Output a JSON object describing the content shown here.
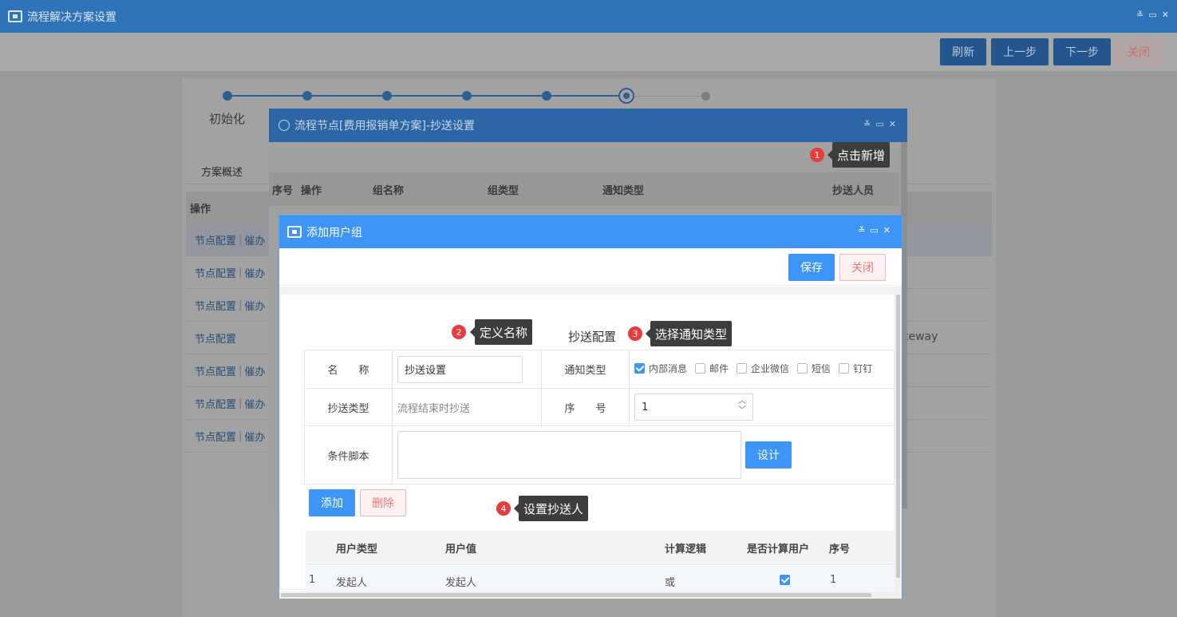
{
  "window": {
    "title": "流程解决方案设置",
    "controls": [
      "≚",
      "▭",
      "✕"
    ]
  },
  "toolbar": {
    "refresh": "刷新",
    "prev": "上一步",
    "next": "下一步",
    "close": "关闭"
  },
  "background": {
    "step_label": "初始化",
    "tab": "方案概述",
    "table_header": "操作",
    "rows": [
      {
        "a": "节点配置",
        "b": "催办"
      },
      {
        "a": "节点配置",
        "b": "催办"
      },
      {
        "a": "节点配置",
        "b": "催办"
      },
      {
        "a": "节点配置",
        "b": ""
      },
      {
        "a": "节点配置",
        "b": "催办"
      },
      {
        "a": "节点配置",
        "b": "催办"
      },
      {
        "a": "节点配置",
        "b": "催办"
      }
    ],
    "gateway_text": "teway"
  },
  "dialog2": {
    "title": "流程节点[费用报销单方案]-抄送设置",
    "columns": [
      "序号",
      "操作",
      "组名称",
      "组类型",
      "通知类型",
      "抄送人员"
    ]
  },
  "dialog1": {
    "title": "添加用户组",
    "save": "保存",
    "close": "关闭",
    "section_title": "抄送配置",
    "form": {
      "name_label": "名　　称",
      "name_value": "抄送设置",
      "notify_label": "通知类型",
      "notify_options": [
        {
          "label": "内部消息",
          "checked": true
        },
        {
          "label": "邮件",
          "checked": false
        },
        {
          "label": "企业微信",
          "checked": false
        },
        {
          "label": "短信",
          "checked": false
        },
        {
          "label": "钉钉",
          "checked": false
        }
      ],
      "cc_type_label": "抄送类型",
      "cc_type_value": "流程结束时抄送",
      "seq_label": "序　　号",
      "seq_value": "1",
      "script_label": "条件脚本",
      "script_value": "",
      "design": "设计"
    },
    "add": "添加",
    "delete": "删除",
    "grid": {
      "headers": [
        "用户类型",
        "用户值",
        "计算逻辑",
        "是否计算用户",
        "序号"
      ],
      "rows": [
        {
          "idx": "1",
          "user_type": "发起人",
          "user_value": "发起人",
          "logic": "或",
          "calc_user": true,
          "seq": "1"
        }
      ]
    }
  },
  "callouts": [
    {
      "num": "1",
      "text": "点击新增"
    },
    {
      "num": "2",
      "text": "定义名称"
    },
    {
      "num": "3",
      "text": "选择通知类型"
    },
    {
      "num": "4",
      "text": "设置抄送人"
    }
  ],
  "colors": {
    "title_blue": "#3d95f7",
    "badge_red": "#e83b3b",
    "tip_dark": "#3d3d3d"
  }
}
